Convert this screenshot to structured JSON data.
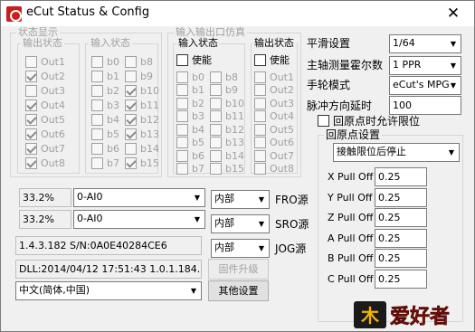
{
  "window": {
    "title": "eCut Status & Config",
    "close_glyph": "✕"
  },
  "status_group": {
    "title": "状态显示",
    "outputs": {
      "title": "输出状态",
      "items": [
        {
          "label": "Out1",
          "checked": false
        },
        {
          "label": "Out2",
          "checked": true
        },
        {
          "label": "Out3",
          "checked": false
        },
        {
          "label": "Out4",
          "checked": true
        },
        {
          "label": "Out5",
          "checked": true
        },
        {
          "label": "Out6",
          "checked": true
        },
        {
          "label": "Out7",
          "checked": true
        },
        {
          "label": "Out8",
          "checked": true
        }
      ]
    },
    "inputs": {
      "title": "输入状态",
      "col1": [
        {
          "label": "b0",
          "checked": false
        },
        {
          "label": "b1",
          "checked": false
        },
        {
          "label": "b2",
          "checked": false
        },
        {
          "label": "b3",
          "checked": false
        },
        {
          "label": "b4",
          "checked": false
        },
        {
          "label": "b5",
          "checked": false
        },
        {
          "label": "b6",
          "checked": false
        },
        {
          "label": "b7",
          "checked": false
        }
      ],
      "col2": [
        {
          "label": "b8",
          "checked": false
        },
        {
          "label": "b9",
          "checked": false
        },
        {
          "label": "b10",
          "checked": true
        },
        {
          "label": "b11",
          "checked": true
        },
        {
          "label": "b12",
          "checked": true
        },
        {
          "label": "b13",
          "checked": true
        },
        {
          "label": "b14",
          "checked": false
        },
        {
          "label": "b15",
          "checked": true
        }
      ]
    }
  },
  "sim_group": {
    "title": "输入输出口仿真",
    "inputs": {
      "title": "输入状态",
      "enable_label": "使能",
      "col1": [
        "b0",
        "b1",
        "b2",
        "b3",
        "b4",
        "b5",
        "b6",
        "b7"
      ],
      "col2": [
        "b8",
        "b9",
        "b10",
        "b11",
        "b12",
        "b13",
        "b14",
        "b15"
      ]
    },
    "outputs": {
      "title": "输出状态",
      "enable_label": "使能",
      "items": [
        "Out1",
        "Out2",
        "Out3",
        "Out4",
        "Out5",
        "Out6",
        "Out7",
        "Out8"
      ]
    }
  },
  "feed_rows": [
    {
      "percent": "33.2%",
      "channel": "0-AI0",
      "mode": "内部",
      "label": "FRO源"
    },
    {
      "percent": "33.2%",
      "channel": "0-AI0",
      "mode": "内部",
      "label": "SRO源"
    }
  ],
  "jog": {
    "mode": "内部",
    "label": "JOG源"
  },
  "device_info": {
    "version": "1.4.3.182 S/N:0A0E40284CE6",
    "dll": "DLL:2014/04/12 17:51:43  1.0.1.184.182",
    "firmware_button": "固件升级",
    "language": "中文(简体,中国)",
    "other_settings_button": "其他设置"
  },
  "right_panel": {
    "smoothing_label": "平滑设置",
    "smoothing_value": "1/64",
    "spindle_label": "主轴测量霍尔数",
    "spindle_value": "1 PPR",
    "handwheel_label": "手轮模式",
    "handwheel_value": "eCut's MPG",
    "pulse_delay_label": "脉冲方向延时",
    "pulse_delay_value": "100",
    "home_limit_label": "回原点时允许限位",
    "home_limit_checked": false
  },
  "home_group": {
    "title": "回原点设置",
    "mode_value": "接触限位后停止",
    "pull_offs": [
      {
        "label": "X Pull Off",
        "value": "0.25"
      },
      {
        "label": "Y Pull Off",
        "value": "0.25"
      },
      {
        "label": "Z Pull Off",
        "value": "0.25"
      },
      {
        "label": "A Pull Off",
        "value": "0.25"
      },
      {
        "label": "B Pull Off",
        "value": "0.25"
      },
      {
        "label": "C Pull Off",
        "value": "0.25"
      }
    ]
  },
  "watermark": {
    "text": "爱好者",
    "prefix": "木"
  },
  "colors": {
    "accent": "#cc1c1c",
    "window_bg": "#f0f0f0",
    "disabled_text": "#a0a0a0"
  }
}
